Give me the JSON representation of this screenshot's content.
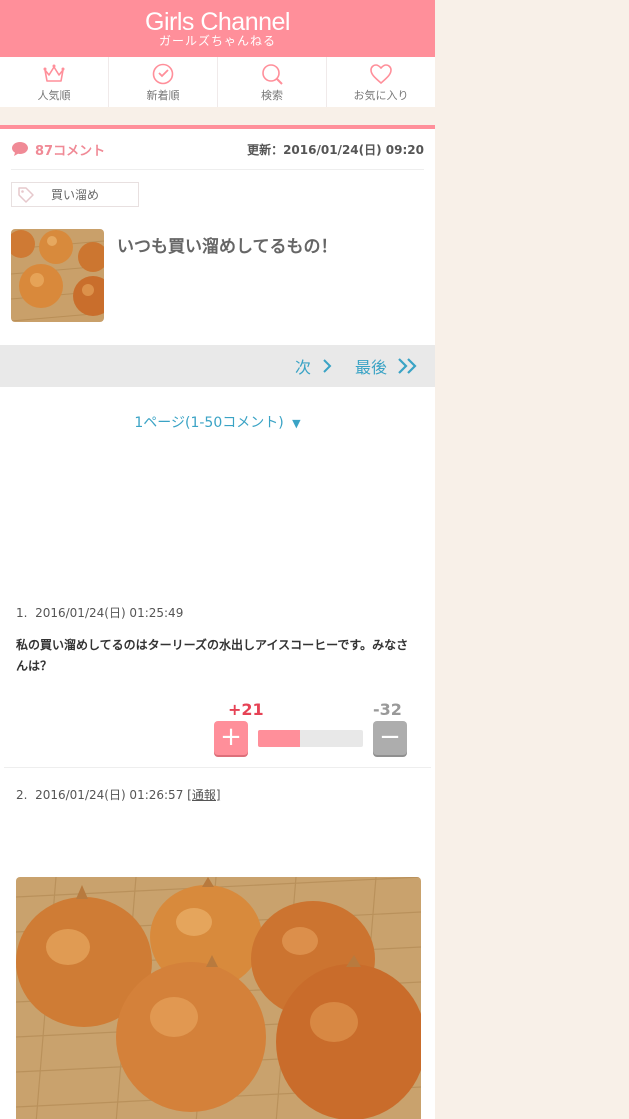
{
  "header": {
    "logo": "Girls Channel",
    "logo_sub": "ガールズちゃんねる"
  },
  "nav": [
    {
      "label": "人気順",
      "icon": "crown-icon"
    },
    {
      "label": "新着順",
      "icon": "check-circle-icon"
    },
    {
      "label": "検索",
      "icon": "search-icon"
    },
    {
      "label": "お気に入り",
      "icon": "heart-icon"
    }
  ],
  "topic": {
    "comment_count": "87コメント",
    "updated": "更新：2016/01/24(日) 09:20",
    "tag": "買い溜め",
    "title": "いつも買い溜めしてるもの！"
  },
  "pager": {
    "next": "次",
    "last": "最後",
    "page_select": "1ページ(1-50コメント)",
    "page_select_arrow": "▼"
  },
  "comments": [
    {
      "number": "1.",
      "date": "2016/01/24(日) 01:25:49",
      "body": "私の買い溜めしてるのはターリーズの水出しアイスコーヒーです。みなさんは？",
      "plus": "+21",
      "minus": "-32",
      "plus_ratio": 0.4
    },
    {
      "number": "2.",
      "date": "2016/01/24(日) 01:26:57",
      "report": "[通報]"
    }
  ],
  "colors": {
    "brand": "#ff8f9a",
    "link": "#3aa3c5",
    "background": "#f8f0e8"
  }
}
